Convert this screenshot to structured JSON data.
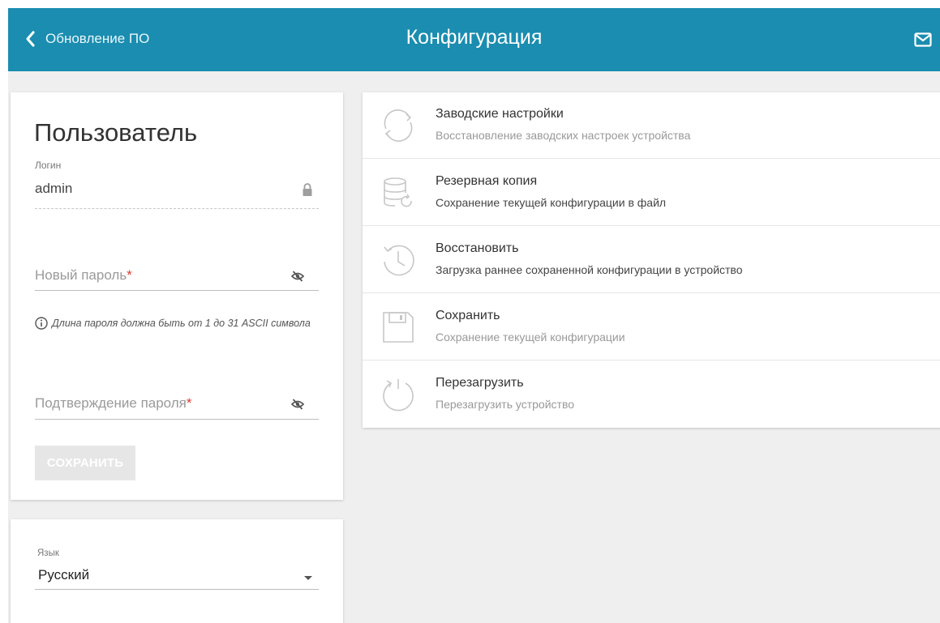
{
  "header": {
    "back_label": "Обновление ПО",
    "title": "Конфигурация",
    "mail_icon": "mail-icon",
    "color": "#1a8db0"
  },
  "user": {
    "title": "Пользователь",
    "login_label": "Логин",
    "login_value": "admin",
    "new_password_placeholder": "Новый пароль",
    "confirm_password_placeholder": "Подтверждение пароля",
    "required_mark": "*",
    "hint": "Длина пароля должна быть от 1 до 31 ASCII символа",
    "save_label": "СОХРАНИТЬ"
  },
  "language": {
    "label": "Язык",
    "value": "Русский"
  },
  "config": {
    "items": [
      {
        "title": "Заводские настройки",
        "desc": "Восстановление заводских настроек устройства",
        "icon": "reset-icon"
      },
      {
        "title": "Резервная копия",
        "desc": "Сохранение текущей конфигурации в файл",
        "icon": "backup-icon"
      },
      {
        "title": "Восстановить",
        "desc": "Загрузка раннее сохраненной конфигурации в устройство",
        "icon": "restore-icon"
      },
      {
        "title": "Сохранить",
        "desc": "Сохранение текущей конфигурации",
        "icon": "save-icon"
      },
      {
        "title": "Перезагрузить",
        "desc": "Перезагрузить устройство",
        "icon": "reboot-icon"
      }
    ]
  },
  "colors": {
    "required": "#e03a2f",
    "icon_gray": "#c7c7c7"
  }
}
